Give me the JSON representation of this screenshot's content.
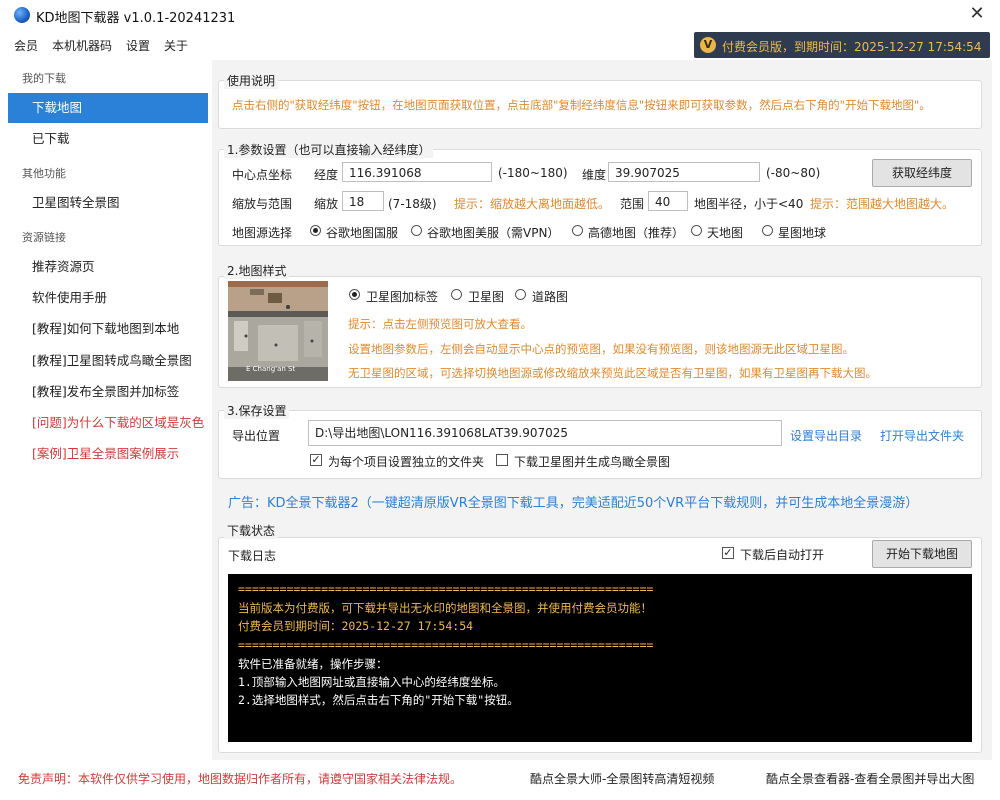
{
  "window": {
    "title": "KD地图下载器 v1.0.1-20241231",
    "close_glyph": "✕"
  },
  "menu": [
    "会员",
    "本机机器码",
    "设置",
    "关于"
  ],
  "vip": {
    "badge": "V",
    "text": "付费会员版，到期时间：2025-12-27 17:54:54"
  },
  "sidebar": {
    "sections": [
      {
        "title": "我的下载",
        "items": [
          {
            "label": "下载地图",
            "active": true
          },
          {
            "label": "已下载"
          }
        ]
      },
      {
        "title": "其他功能",
        "items": [
          {
            "label": "卫星图转全景图"
          }
        ]
      },
      {
        "title": "资源链接",
        "items": [
          {
            "label": "推荐资源页"
          },
          {
            "label": "软件使用手册"
          },
          {
            "label": "[教程]如何下载地图到本地"
          },
          {
            "label": "[教程]卫星图转成鸟瞰全景图"
          },
          {
            "label": "[教程]发布全景图并加标签"
          },
          {
            "label": "[问题]为什么下载的区域是灰色",
            "red": true
          },
          {
            "label": "[案例]卫星全景图案例展示",
            "red": true
          }
        ]
      }
    ]
  },
  "usage": {
    "title": "使用说明",
    "text": "点击右侧的\"获取经纬度\"按钮，在地图页面获取位置，点击底部\"复制经纬度信息\"按钮来即可获取参数，然后点右下角的\"开始下载地图\"。"
  },
  "params": {
    "title": "1.参数设置（也可以直接输入经纬度）",
    "center_label": "中心点坐标",
    "lng_label": "经度",
    "lng_value": "116.391068",
    "lng_range": "(-180~180)",
    "lat_label": "维度",
    "lat_value": "39.907025",
    "lat_range": "(-80~80)",
    "get_button": "获取经纬度",
    "zoom_row_label": "缩放与范围",
    "zoom_label": "缩放",
    "zoom_value": "18",
    "zoom_range": "(7-18级)",
    "zoom_hint": "提示：缩放越大离地面越低。",
    "range_label": "范围",
    "range_value": "40",
    "range_desc": "地图半径，小于<40",
    "range_hint": "提示：范围越大地图越大。",
    "source_label": "地图源选择",
    "sources": [
      {
        "label": "谷歌地图国服",
        "selected": true
      },
      {
        "label": "谷歌地图美服（需VPN）"
      },
      {
        "label": "高德地图（推荐）"
      },
      {
        "label": "天地图"
      },
      {
        "label": "星图地球"
      }
    ]
  },
  "style": {
    "title": "2.地图样式",
    "preview_caption": "E Chang'an St",
    "options": [
      {
        "label": "卫星图加标签",
        "selected": true
      },
      {
        "label": "卫星图"
      },
      {
        "label": "道路图"
      }
    ],
    "hints": [
      "提示：点击左侧预览图可放大查看。",
      "设置地图参数后，左侧会自动显示中心点的预览图，如果没有预览图，则该地图源无此区域卫星图。",
      "无卫星图的区域，可选择切换地图源或修改缩放来预览此区域是否有卫星图，如果有卫星图再下载大图。"
    ]
  },
  "save": {
    "title": "3.保存设置",
    "path_label": "导出位置",
    "path_value": "D:\\导出地图\\LON116.391068LAT39.907025",
    "set_link": "设置导出目录",
    "open_link": "打开导出文件夹",
    "check1": {
      "label": "为每个项目设置独立的文件夹",
      "checked": true
    },
    "check2": {
      "label": "下载卫星图并生成鸟瞰全景图",
      "checked": false
    }
  },
  "ad": "广告：KD全景下载器2（一键超清原版VR全景图下载工具，完美适配近50个VR平台下载规则，并可生成本地全景漫游）",
  "status": {
    "title": "下载状态",
    "log_label": "下载日志",
    "auto_open": {
      "label": "下载后自动打开",
      "checked": true
    },
    "start_button": "开始下载地图",
    "log_lines": [
      "============================================================",
      "当前版本为付费版，可下载并导出无水印的地图和全景图，并使用付费会员功能！",
      "付费会员到期时间：2025-12-27 17:54:54",
      "============================================================",
      "软件已准备就绪，操作步骤：",
      "1.顶部输入地图网址或直接输入中心的经纬度坐标。",
      "2.选择地图样式，然后点击右下角的\"开始下载\"按钮。"
    ]
  },
  "footer": {
    "disclaimer": "免责声明：本软件仅供学习使用，地图数据归作者所有，请遵守国家相关法律法规。",
    "link1": "酷点全景大师-全景图转高清短视频",
    "link2": "酷点全景查看器-查看全景图并导出大图"
  },
  "colors": {
    "accent": "#2b80d8",
    "hint": "#e08a2e",
    "warn": "#d53a3a",
    "vip_bg": "#2f3b4f",
    "vip_text": "#f0b94f"
  }
}
